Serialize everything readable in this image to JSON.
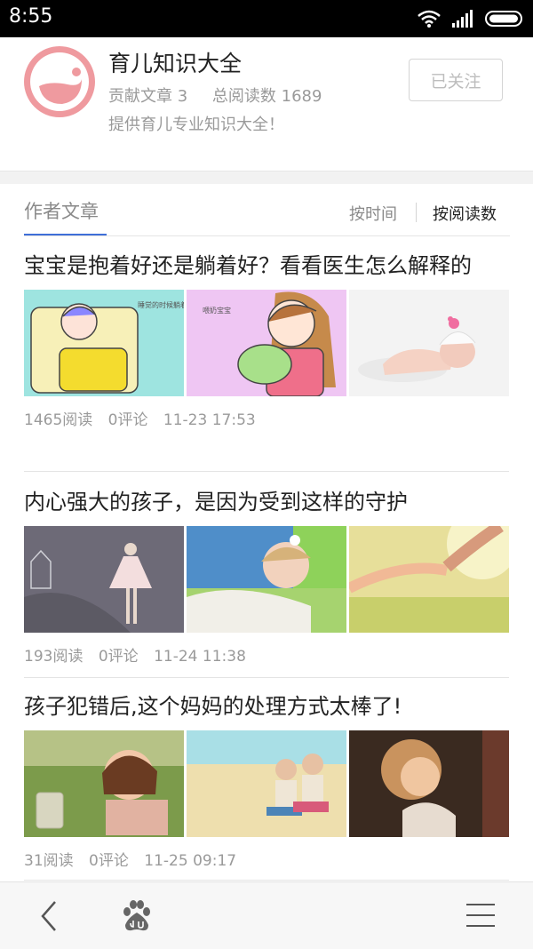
{
  "status_bar": {
    "time": "8:55"
  },
  "author": {
    "name": "育儿知识大全",
    "articles_label": "贡献文章 3",
    "reads_label": "总阅读数 1689",
    "description": "提供育儿专业知识大全！",
    "follow_button": "已关注"
  },
  "tabs": {
    "author_articles": "作者文章",
    "sort_by_time": "按时间",
    "sort_by_reads": "按阅读数"
  },
  "articles": [
    {
      "title": "宝宝是抱着好还是躺着好？看看医生怎么解释的",
      "reads": "1465阅读",
      "comments": "0评论",
      "time": "11-23 17:53",
      "image_captions": [
        "睡觉的时候躺着好",
        "喂奶宝宝"
      ]
    },
    {
      "title": "内心强大的孩子，是因为受到这样的守护",
      "reads": "193阅读",
      "comments": "0评论",
      "time": "11-24 11:38"
    },
    {
      "title": "孩子犯错后,这个妈妈的处理方式太棒了!",
      "reads": "31阅读",
      "comments": "0评论",
      "time": "11-25 09:17"
    }
  ],
  "nav": {
    "back_icon": "back-icon",
    "home_icon": "baidu-paw-icon",
    "menu_icon": "menu-icon"
  },
  "colors": {
    "accent": "#3e6fd8",
    "avatar_pink": "#ef9a9f"
  }
}
